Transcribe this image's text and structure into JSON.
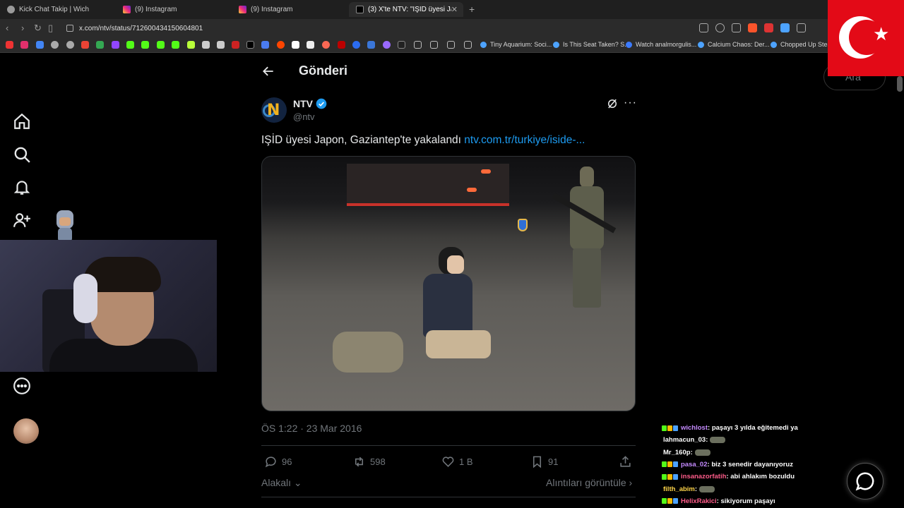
{
  "browser": {
    "tabs": [
      {
        "label": "Kick Chat Takip | Wich",
        "active": false
      },
      {
        "label": "(9) Instagram",
        "active": false
      },
      {
        "label": "(9) Instagram",
        "active": false
      },
      {
        "label": "(3) X'te NTV: \"IŞİD üyesi Japon, G",
        "active": true
      }
    ],
    "url": "x.com/ntv/status/712600434150604801",
    "bookmarks": [
      "Tiny Aquarium: Soci...",
      "Is This Seat Taken? S...",
      "Watch analmorgulis...",
      "Calcium Chaos: Der...",
      "Chopped Up Steam"
    ]
  },
  "sidebar": {
    "search_placeholder": "Ara",
    "items": [
      "home-icon",
      "search-icon",
      "notifications-icon",
      "follow-icon",
      "more-circle-icon"
    ]
  },
  "post": {
    "page_title": "Gönderi",
    "author_name": "NTV",
    "author_handle": "@ntv",
    "text": "IŞİD üyesi Japon, Gaziantep'te yakalandı ",
    "link_text": "ntv.com.tr/turkiye/iside-...",
    "timestamp": "ÖS 1:22 · 23 Mar 2016",
    "stats": {
      "replies": "96",
      "reposts": "598",
      "likes": "1 B",
      "bookmarks": "91"
    },
    "relevance_label": "Alakalı",
    "quotes_label": "Alıntıları görüntüle"
  },
  "chat": {
    "messages": [
      {
        "user": "wichlost",
        "color": "#c58bff",
        "text": ": paşayı 3 yılda eğitemedi ya",
        "emote": false
      },
      {
        "user": "lahmacun_03",
        "color": "#ffffff",
        "text": ":",
        "emote": true
      },
      {
        "user": "Mr_160p",
        "color": "#ffffff",
        "text": ":",
        "emote": true
      },
      {
        "user": "pasa_02",
        "color": "#c58bff",
        "text": ": biz 3 senedir dayanıyoruz",
        "emote": false
      },
      {
        "user": "insanazorfatih",
        "color": "#ff5c8a",
        "text": ": abi ahlakım bozuldu",
        "emote": false
      },
      {
        "user": "filth_abim",
        "color": "#ffd54a",
        "text": ":",
        "emote": true
      },
      {
        "user": "HelixRakici",
        "color": "#ff5c8a",
        "text": ": sikiyorum paşayı",
        "emote": false
      }
    ]
  },
  "colors": {
    "accent": "#1d9bf0",
    "verified": "#1d9bf0",
    "flag_red": "#e30a17"
  }
}
